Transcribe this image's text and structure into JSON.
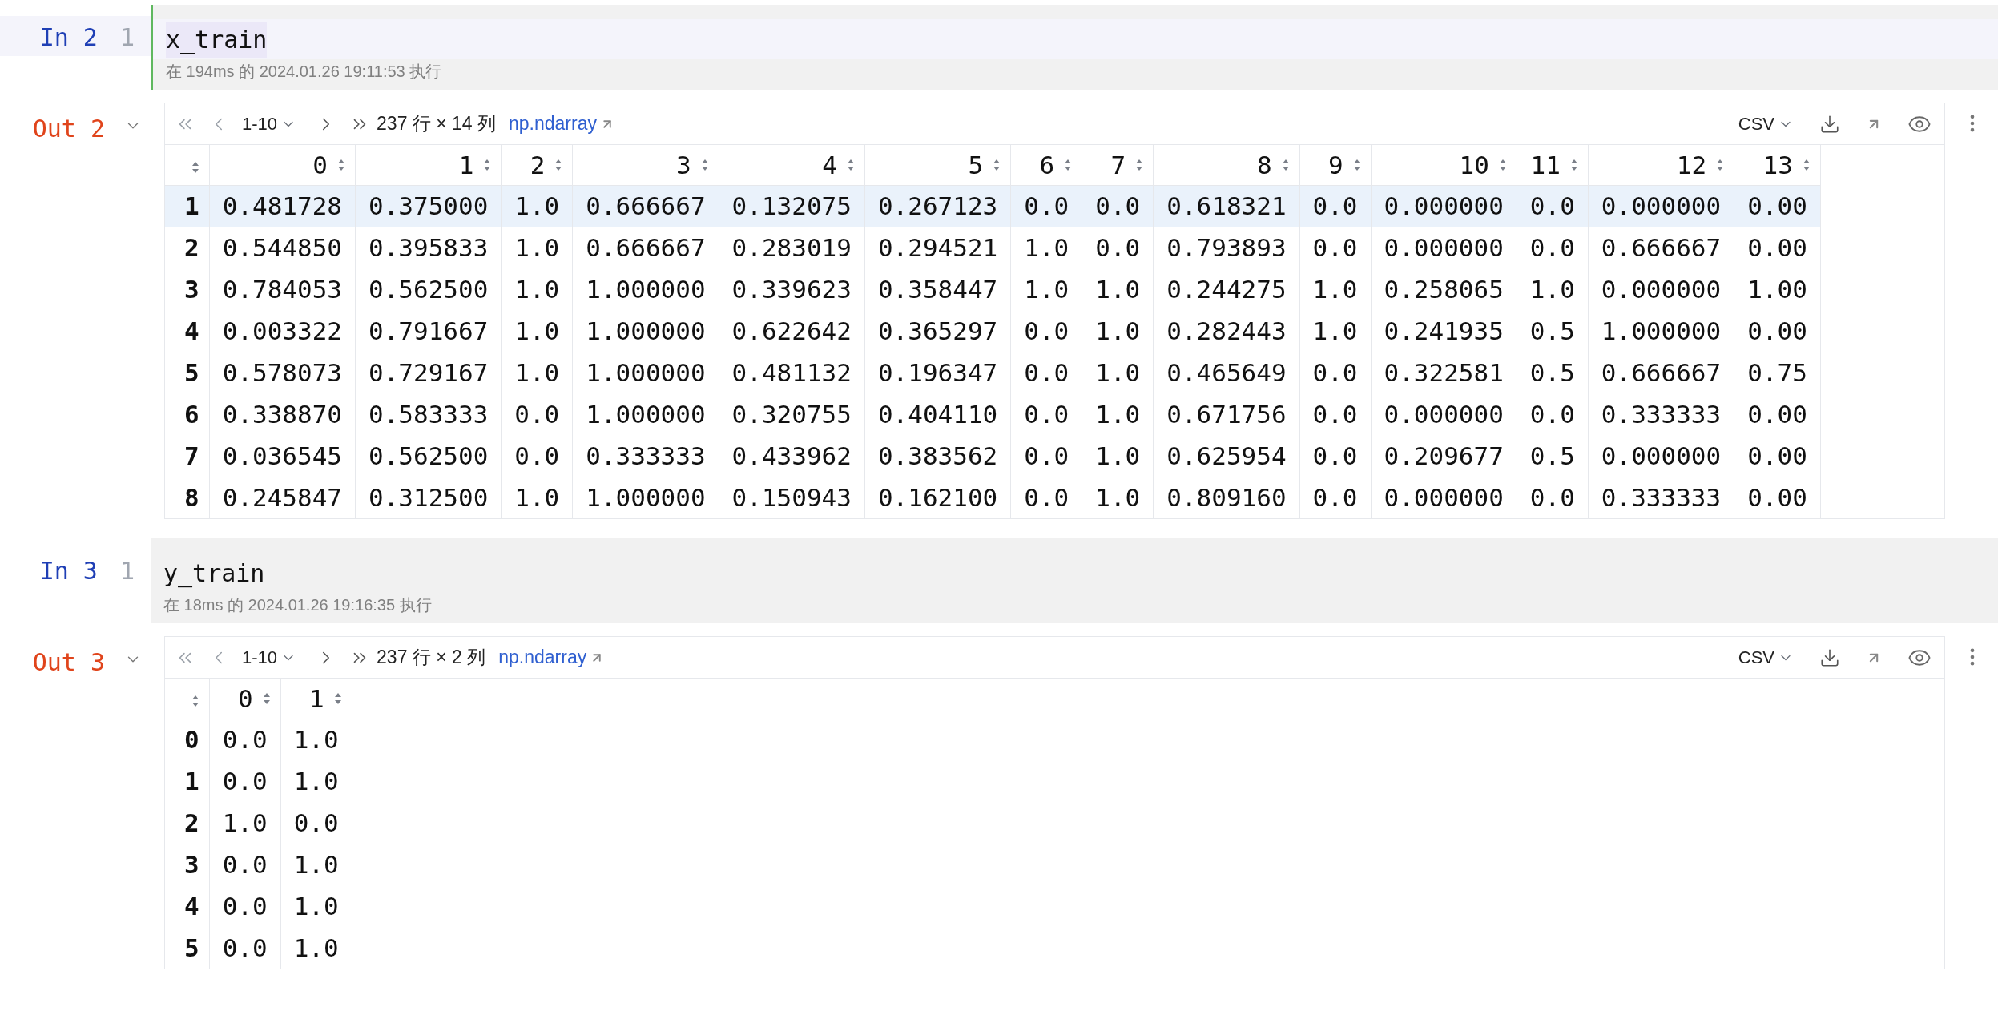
{
  "cells": [
    {
      "input": {
        "prompt": "In 2",
        "line_number": "1",
        "code": "x_train",
        "run_info": "在 194ms 的 2024.01.26 19:11:53 执行",
        "active": true
      },
      "output": {
        "prompt": "Out 2",
        "expanded": true,
        "toolbar": {
          "page_range": "1-10",
          "shape": "237 行 × 14 列",
          "type_link": "np.ndarray",
          "format": "CSV"
        },
        "table": {
          "columns": [
            "0",
            "1",
            "2",
            "3",
            "4",
            "5",
            "6",
            "7",
            "8",
            "9",
            "10",
            "11",
            "12",
            "13"
          ],
          "rows": [
            {
              "index": "1",
              "selected": true,
              "cells": [
                "0.481728",
                "0.375000",
                "1.0",
                "0.666667",
                "0.132075",
                "0.267123",
                "0.0",
                "0.0",
                "0.618321",
                "0.0",
                "0.000000",
                "0.0",
                "0.000000",
                "0.00"
              ]
            },
            {
              "index": "2",
              "selected": false,
              "cells": [
                "0.544850",
                "0.395833",
                "1.0",
                "0.666667",
                "0.283019",
                "0.294521",
                "1.0",
                "0.0",
                "0.793893",
                "0.0",
                "0.000000",
                "0.0",
                "0.666667",
                "0.00"
              ]
            },
            {
              "index": "3",
              "selected": false,
              "cells": [
                "0.784053",
                "0.562500",
                "1.0",
                "1.000000",
                "0.339623",
                "0.358447",
                "1.0",
                "1.0",
                "0.244275",
                "1.0",
                "0.258065",
                "1.0",
                "0.000000",
                "1.00"
              ]
            },
            {
              "index": "4",
              "selected": false,
              "cells": [
                "0.003322",
                "0.791667",
                "1.0",
                "1.000000",
                "0.622642",
                "0.365297",
                "0.0",
                "1.0",
                "0.282443",
                "1.0",
                "0.241935",
                "0.5",
                "1.000000",
                "0.00"
              ]
            },
            {
              "index": "5",
              "selected": false,
              "cells": [
                "0.578073",
                "0.729167",
                "1.0",
                "1.000000",
                "0.481132",
                "0.196347",
                "0.0",
                "1.0",
                "0.465649",
                "0.0",
                "0.322581",
                "0.5",
                "0.666667",
                "0.75"
              ]
            },
            {
              "index": "6",
              "selected": false,
              "cells": [
                "0.338870",
                "0.583333",
                "0.0",
                "1.000000",
                "0.320755",
                "0.404110",
                "0.0",
                "1.0",
                "0.671756",
                "0.0",
                "0.000000",
                "0.0",
                "0.333333",
                "0.00"
              ]
            },
            {
              "index": "7",
              "selected": false,
              "cells": [
                "0.036545",
                "0.562500",
                "0.0",
                "0.333333",
                "0.433962",
                "0.383562",
                "0.0",
                "1.0",
                "0.625954",
                "0.0",
                "0.209677",
                "0.5",
                "0.000000",
                "0.00"
              ]
            },
            {
              "index": "8",
              "selected": false,
              "cells": [
                "0.245847",
                "0.312500",
                "1.0",
                "1.000000",
                "0.150943",
                "0.162100",
                "0.0",
                "1.0",
                "0.809160",
                "0.0",
                "0.000000",
                "0.0",
                "0.333333",
                "0.00"
              ]
            }
          ]
        }
      }
    },
    {
      "input": {
        "prompt": "In 3",
        "line_number": "1",
        "code": "y_train",
        "run_info": "在 18ms 的 2024.01.26 19:16:35 执行",
        "active": false
      },
      "output": {
        "prompt": "Out 3",
        "expanded": true,
        "toolbar": {
          "page_range": "1-10",
          "shape": "237 行 × 2 列",
          "type_link": "np.ndarray",
          "format": "CSV"
        },
        "table": {
          "columns": [
            "0",
            "1"
          ],
          "rows": [
            {
              "index": "0",
              "selected": false,
              "cells": [
                "0.0",
                "1.0"
              ]
            },
            {
              "index": "1",
              "selected": false,
              "cells": [
                "0.0",
                "1.0"
              ]
            },
            {
              "index": "2",
              "selected": false,
              "cells": [
                "1.0",
                "0.0"
              ]
            },
            {
              "index": "3",
              "selected": false,
              "cells": [
                "0.0",
                "1.0"
              ]
            },
            {
              "index": "4",
              "selected": false,
              "cells": [
                "0.0",
                "1.0"
              ]
            },
            {
              "index": "5",
              "selected": false,
              "cells": [
                "0.0",
                "1.0"
              ]
            }
          ]
        }
      }
    }
  ]
}
